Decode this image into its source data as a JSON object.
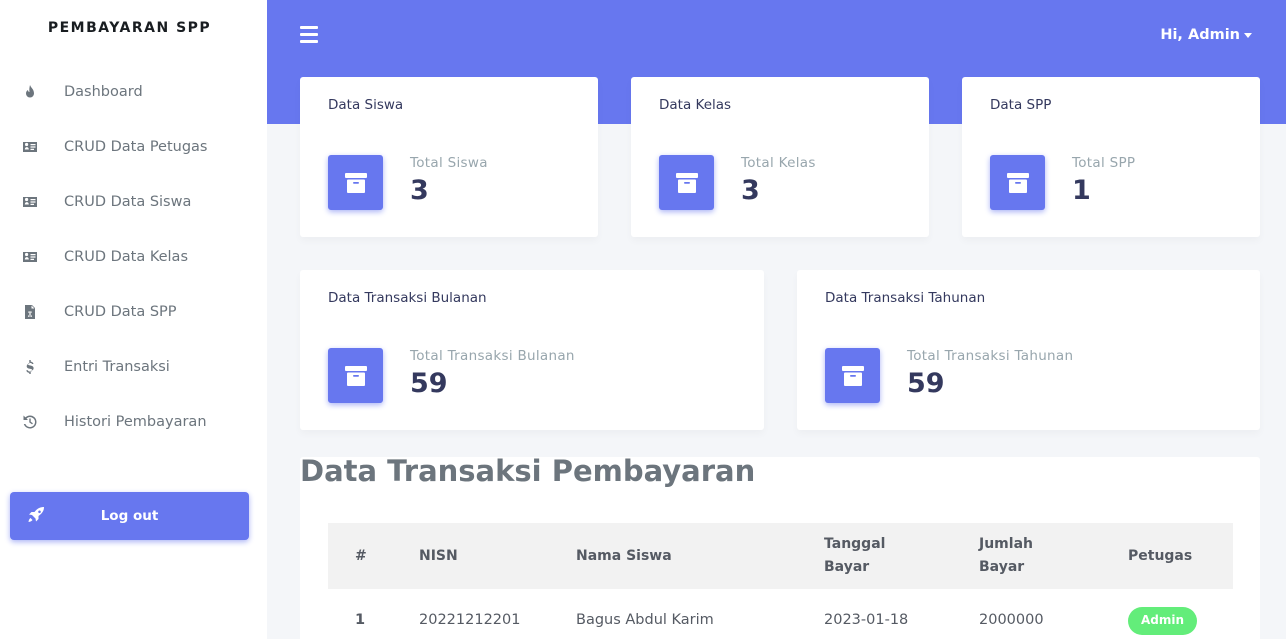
{
  "sidebar": {
    "brand": "PEMBAYARAN SPP",
    "items": [
      {
        "label": "Dashboard",
        "icon": "fire-icon"
      },
      {
        "label": "CRUD Data Petugas",
        "icon": "id-card-icon"
      },
      {
        "label": "CRUD Data Siswa",
        "icon": "id-card-icon"
      },
      {
        "label": "CRUD Data Kelas",
        "icon": "id-card-icon"
      },
      {
        "label": "CRUD Data SPP",
        "icon": "file-invoice-icon"
      },
      {
        "label": "Entri Transaksi",
        "icon": "dollar-icon"
      },
      {
        "label": "Histori Pembayaran",
        "icon": "history-icon"
      }
    ],
    "logout_label": "Log out"
  },
  "header": {
    "user_greeting": "Hi, Admin"
  },
  "cards": [
    {
      "title": "Data Siswa",
      "label": "Total Siswa",
      "value": "3"
    },
    {
      "title": "Data Kelas",
      "label": "Total Kelas",
      "value": "3"
    },
    {
      "title": "Data SPP",
      "label": "Total SPP",
      "value": "1"
    },
    {
      "title": "Data Transaksi Bulanan",
      "label": "Total Transaksi Bulanan",
      "value": "59"
    },
    {
      "title": "Data Transaksi Tahunan",
      "label": "Total Transaksi Tahunan",
      "value": "59"
    }
  ],
  "table": {
    "title": "Data Transaksi Pembayaran",
    "headers": {
      "no": "#",
      "nisn": "NISN",
      "nama": "Nama Siswa",
      "tanggal_1": "Tanggal",
      "tanggal_2": "Bayar",
      "jumlah_1": "Jumlah",
      "jumlah_2": "Bayar",
      "petugas": "Petugas"
    },
    "rows": [
      {
        "no": "1",
        "nisn": "20221212201",
        "nama": "Bagus Abdul Karim",
        "tanggal": "2023-01-18",
        "jumlah": "2000000",
        "petugas": "Admin"
      }
    ]
  },
  "colors": {
    "primary": "#6777ef",
    "success": "#63ed7a",
    "background": "#f4f6f9"
  }
}
